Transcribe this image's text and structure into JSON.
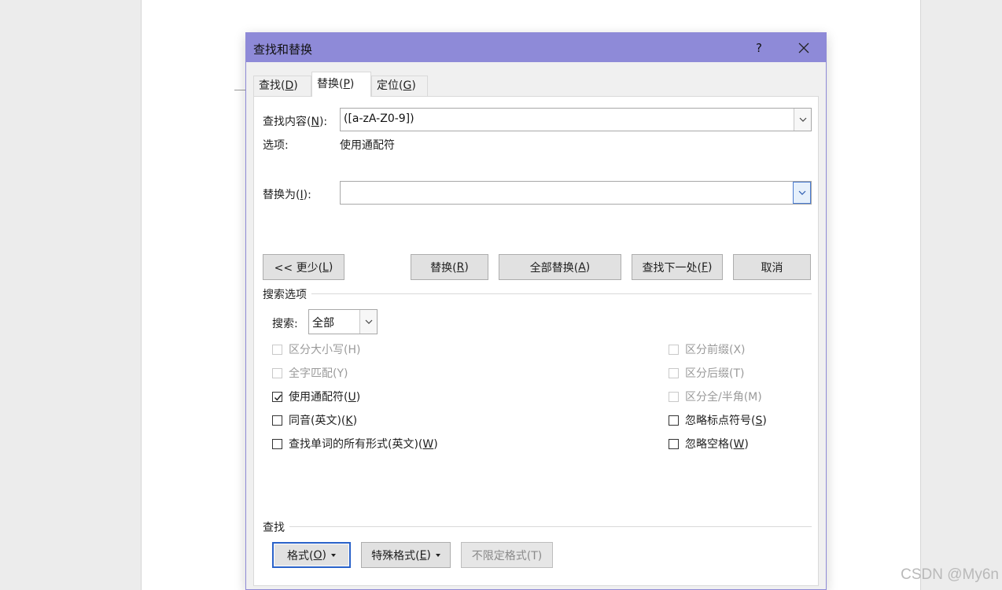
{
  "dialog": {
    "title": "查找和替换",
    "help": "?"
  },
  "tabs": [
    {
      "label": "查找(",
      "key": "D",
      "suffix": ")",
      "active": false
    },
    {
      "label": "替换(",
      "key": "P",
      "suffix": ")",
      "active": true
    },
    {
      "label": "定位(",
      "key": "G",
      "suffix": ")",
      "active": false
    }
  ],
  "find": {
    "label": "查找内容(",
    "key": "N",
    "suffix": "):",
    "value": "([a-zA-Z0-9])"
  },
  "options": {
    "label": "选项:",
    "value": "使用通配符"
  },
  "replace": {
    "label": "替换为(",
    "key": "I",
    "suffix": "):",
    "value": ""
  },
  "buttons": {
    "less": {
      "pre": "<< 更少(",
      "key": "L",
      "post": ")"
    },
    "replace": {
      "pre": "替换(",
      "key": "R",
      "post": ")"
    },
    "replace_all": {
      "pre": "全部替换(",
      "key": "A",
      "post": ")"
    },
    "find_next": {
      "pre": "查找下一处(",
      "key": "F",
      "post": ")"
    },
    "cancel": "取消"
  },
  "search_options": {
    "title": "搜索选项",
    "search_label": "搜索:",
    "search_value": "全部"
  },
  "checkboxes_left": [
    {
      "label": "区分大小写(H)",
      "checked": false,
      "disabled": true
    },
    {
      "label": "全字匹配(Y)",
      "checked": false,
      "disabled": true
    },
    {
      "pre": "使用通配符(",
      "key": "U",
      "post": ")",
      "checked": true,
      "disabled": false
    },
    {
      "pre": "同音(英文)(",
      "key": "K",
      "post": ")",
      "checked": false,
      "disabled": false
    },
    {
      "pre": "查找单词的所有形式(英文)(",
      "key": "W",
      "post": ")",
      "checked": false,
      "disabled": false
    }
  ],
  "checkboxes_right": [
    {
      "label": "区分前缀(X)",
      "checked": false,
      "disabled": true
    },
    {
      "label": "区分后缀(T)",
      "checked": false,
      "disabled": true
    },
    {
      "label": "区分全/半角(M)",
      "checked": false,
      "disabled": true
    },
    {
      "pre": "忽略标点符号(",
      "key": "S",
      "post": ")",
      "checked": false,
      "disabled": false
    },
    {
      "pre": "忽略空格(",
      "key": "W",
      "post": ")",
      "checked": false,
      "disabled": false
    }
  ],
  "find_section": {
    "title": "查找",
    "format": {
      "pre": "格式(",
      "key": "O",
      "post": ")"
    },
    "special": {
      "pre": "特殊格式(",
      "key": "E",
      "post": ")"
    },
    "no_format": "不限定格式(T)"
  },
  "watermark": "CSDN @My6n",
  "colors": {
    "titlebar": "#8e8ad8",
    "focus": "#2a62c9"
  }
}
